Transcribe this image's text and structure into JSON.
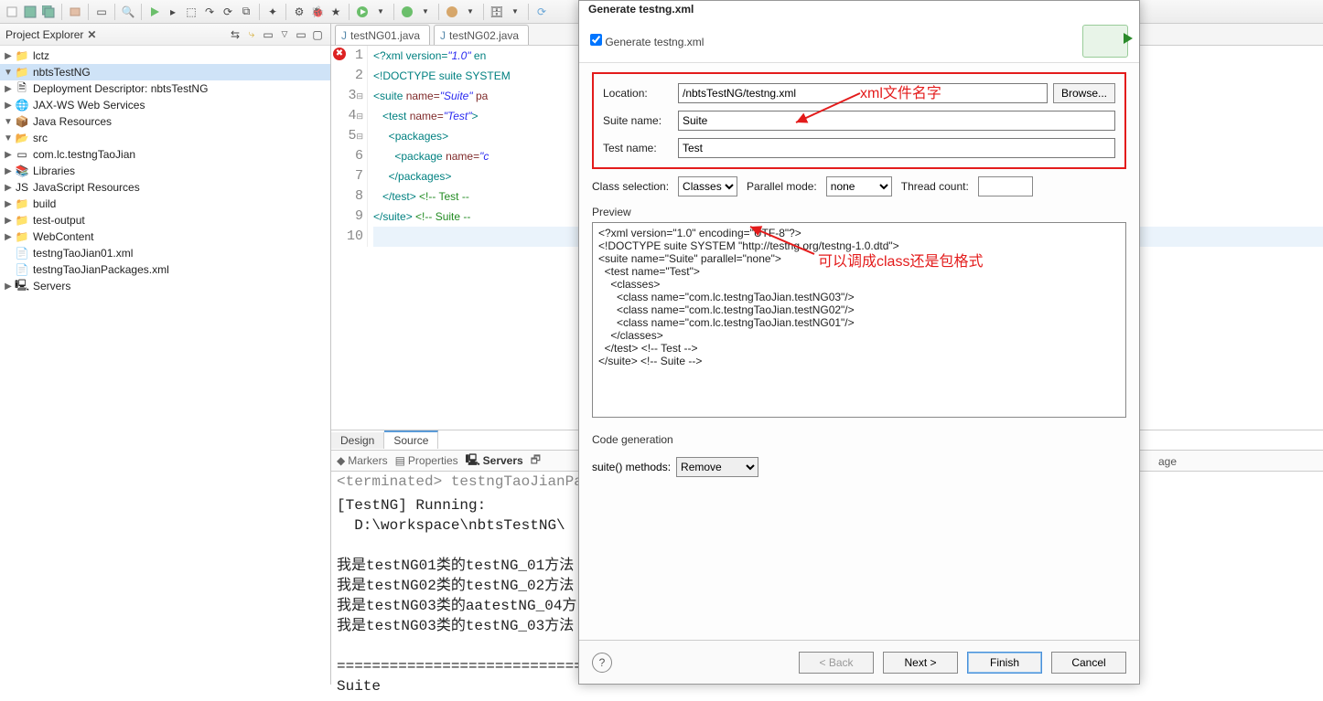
{
  "toolbar_icons": [
    "new",
    "save",
    "saveall",
    "sep",
    "package",
    "sep",
    "box",
    "sep",
    "search",
    "sep",
    "play",
    "debug",
    "stop",
    "skip",
    "history",
    "rec",
    "sep",
    "wand",
    "sep",
    "gear",
    "bug",
    "star",
    "sep",
    "run-green",
    "sep",
    "ext1",
    "sep",
    "ext2",
    "sep",
    "db",
    "sep",
    "server"
  ],
  "project_explorer": {
    "title": "Project Explorer",
    "items": [
      {
        "ind": 0,
        "arr": "▶",
        "icon": "prj",
        "label": "lctz"
      },
      {
        "ind": 0,
        "arr": "▼",
        "icon": "prj",
        "label": "nbtsTestNG",
        "sel": true
      },
      {
        "ind": 1,
        "arr": "▶",
        "icon": "dd",
        "label": "Deployment Descriptor: nbtsTestNG"
      },
      {
        "ind": 1,
        "arr": "▶",
        "icon": "ws",
        "label": "JAX-WS Web Services"
      },
      {
        "ind": 1,
        "arr": "▼",
        "icon": "jar",
        "label": "Java Resources"
      },
      {
        "ind": 2,
        "arr": "▼",
        "icon": "src",
        "label": "src"
      },
      {
        "ind": 3,
        "arr": "▶",
        "icon": "pkg",
        "label": "com.lc.testngTaoJian"
      },
      {
        "ind": 2,
        "arr": "▶",
        "icon": "lib",
        "label": "Libraries"
      },
      {
        "ind": 1,
        "arr": "▶",
        "icon": "js",
        "label": "JavaScript Resources"
      },
      {
        "ind": 1,
        "arr": "▶",
        "icon": "fld",
        "label": "build"
      },
      {
        "ind": 1,
        "arr": "▶",
        "icon": "fld",
        "label": "test-output"
      },
      {
        "ind": 1,
        "arr": "▶",
        "icon": "fld",
        "label": "WebContent"
      },
      {
        "ind": 1,
        "arr": "",
        "icon": "xml",
        "label": "testngTaoJian01.xml"
      },
      {
        "ind": 1,
        "arr": "",
        "icon": "xml",
        "label": "testngTaoJianPackages.xml"
      },
      {
        "ind": 0,
        "arr": "▶",
        "icon": "srv",
        "label": "Servers"
      }
    ]
  },
  "editor": {
    "tabs": [
      {
        "icon": "j",
        "label": "testNG01.java"
      },
      {
        "icon": "j",
        "label": "testNG02.java"
      }
    ],
    "gutter": [
      "1",
      "2",
      "3",
      "4",
      "5",
      "6",
      "7",
      "8",
      "9",
      "10"
    ],
    "gutter_marks": {
      "0": "err",
      "2": "fold",
      "3": "fold",
      "4": "fold"
    },
    "lines": [
      [
        {
          "t": "<?",
          "c": "teal"
        },
        {
          "t": "xml version=",
          "c": "teal"
        },
        {
          "t": "\"1.0\"",
          "c": "str"
        },
        {
          "t": " en",
          "c": "teal"
        }
      ],
      [
        {
          "t": "<!DOCTYPE ",
          "c": "teal"
        },
        {
          "t": "suite ",
          "c": "teal"
        },
        {
          "t": "SYSTEM",
          "c": "teal"
        }
      ],
      [
        {
          "t": "<",
          "c": "teal"
        },
        {
          "t": "suite ",
          "c": "teal"
        },
        {
          "t": "name=",
          "c": "brown"
        },
        {
          "t": "\"Suite\"",
          "c": "str"
        },
        {
          "t": " pa",
          "c": "brown"
        }
      ],
      [
        {
          "t": "   <",
          "c": "teal"
        },
        {
          "t": "test ",
          "c": "teal"
        },
        {
          "t": "name=",
          "c": "brown"
        },
        {
          "t": "\"Test\"",
          "c": "str"
        },
        {
          "t": ">",
          "c": "teal"
        }
      ],
      [
        {
          "t": "     <",
          "c": "teal"
        },
        {
          "t": "packages",
          "c": "teal"
        },
        {
          "t": ">",
          "c": "teal"
        }
      ],
      [
        {
          "t": "       <",
          "c": "teal"
        },
        {
          "t": "package ",
          "c": "teal"
        },
        {
          "t": "name=",
          "c": "brown"
        },
        {
          "t": "\"c",
          "c": "str"
        }
      ],
      [
        {
          "t": "     </",
          "c": "teal"
        },
        {
          "t": "packages",
          "c": "teal"
        },
        {
          "t": ">",
          "c": "teal"
        }
      ],
      [
        {
          "t": "   </",
          "c": "teal"
        },
        {
          "t": "test",
          "c": "teal"
        },
        {
          "t": "> ",
          "c": "teal"
        },
        {
          "t": "<!-- Test --",
          "c": "green"
        }
      ],
      [
        {
          "t": "</",
          "c": "teal"
        },
        {
          "t": "suite",
          "c": "teal"
        },
        {
          "t": "> ",
          "c": "teal"
        },
        {
          "t": "<!-- Suite --",
          "c": "green"
        }
      ],
      []
    ],
    "bottom_tabs": [
      "Design",
      "Source"
    ],
    "active_bottom": 1
  },
  "views": [
    "Markers",
    "Properties",
    "Servers"
  ],
  "console": {
    "terminated": "<terminated> testngTaoJianPackages.xml [T",
    "lines": [
      "[TestNG] Running:",
      "  D:\\workspace\\nbtsTestNG\\",
      "",
      "我是testNG01类的testNG_01方法",
      "我是testNG02类的testNG_02方法",
      "我是testNG03类的aatestNG_04方",
      "我是testNG03类的testNG_03方法",
      "",
      "=============================",
      "Suite"
    ]
  },
  "dialog": {
    "title": "Generate testng.xml",
    "checkbox_label": "Generate testng.xml",
    "location_label": "Location:",
    "location_value": "/nbtsTestNG/testng.xml",
    "browse": "Browse...",
    "suite_label": "Suite name:",
    "suite_value": "Suite",
    "test_label": "Test name:",
    "test_value": "Test",
    "class_sel_label": "Class selection:",
    "class_sel_value": "Classes",
    "parallel_label": "Parallel mode:",
    "parallel_value": "none",
    "thread_label": "Thread count:",
    "preview_label": "Preview",
    "preview_text": "<?xml version=\"1.0\" encoding=\"UTF-8\"?>\n<!DOCTYPE suite SYSTEM \"http://testng.org/testng-1.0.dtd\">\n<suite name=\"Suite\" parallel=\"none\">\n  <test name=\"Test\">\n    <classes>\n      <class name=\"com.lc.testngTaoJian.testNG03\"/>\n      <class name=\"com.lc.testngTaoJian.testNG02\"/>\n      <class name=\"com.lc.testngTaoJian.testNG01\"/>\n    </classes>\n  </test> <!-- Test -->\n</suite> <!-- Suite -->\n",
    "codegen_label": "Code generation",
    "suite_methods_label": "suite() methods:",
    "suite_methods_value": "Remove",
    "back": "< Back",
    "next": "Next >",
    "finish": "Finish",
    "cancel": "Cancel"
  },
  "annotations": {
    "a1": "xml文件名字",
    "a2": "可以调成class还是包格式"
  },
  "right_text": "age"
}
